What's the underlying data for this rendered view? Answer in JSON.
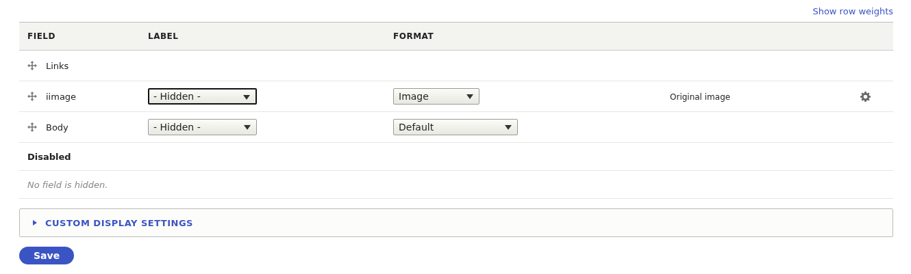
{
  "top_link": "Show row weights",
  "table": {
    "columns": [
      "FIELD",
      "LABEL",
      "FORMAT"
    ],
    "rows": [
      {
        "field": "Links"
      },
      {
        "field": "iimage",
        "label": {
          "value": "- Hidden -",
          "focused": true
        },
        "format": {
          "value": "Image"
        },
        "summary": "Original image",
        "settings": true
      },
      {
        "field": "Body",
        "label": {
          "value": "- Hidden -",
          "focused": false
        },
        "format": {
          "value": "Default"
        }
      }
    ],
    "region": {
      "title": "Disabled",
      "empty": "No field is hidden."
    }
  },
  "details": {
    "title": "CUSTOM DISPLAY SETTINGS",
    "expanded": false
  },
  "save_button": "Save"
}
